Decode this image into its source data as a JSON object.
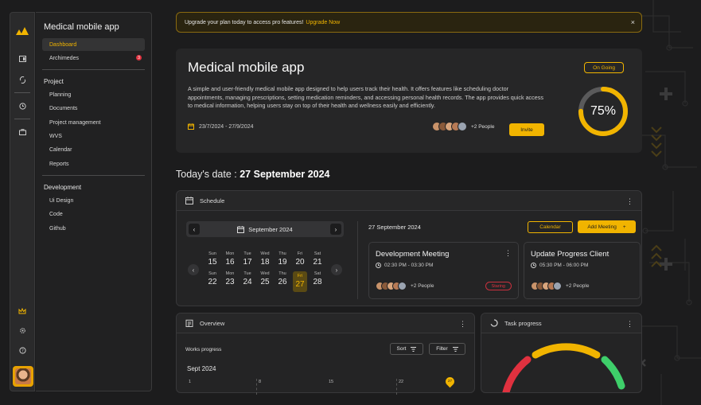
{
  "colors": {
    "accent": "#f1b400",
    "danger": "#e0313f",
    "success": "#3ecf6a"
  },
  "rail": {
    "icons": [
      "logo-icon",
      "window-icon",
      "link-icon",
      "history-icon",
      "briefcase-icon",
      "crown-icon",
      "settings-icon",
      "help-icon"
    ]
  },
  "sidebar": {
    "title": "Medical mobile app",
    "top_items": [
      {
        "label": "Dashboard",
        "active": true
      },
      {
        "label": "Archimedes",
        "badge": "3"
      }
    ],
    "groups": [
      {
        "title": "Project",
        "items": [
          "Planning",
          "Documents",
          "Project management",
          "WVS",
          "Calendar",
          "Reports"
        ]
      },
      {
        "title": "Development",
        "items": [
          "Ui Design",
          "Code",
          "Github"
        ]
      }
    ]
  },
  "banner": {
    "text": "Upgrade your plan today to access pro features!",
    "link": "Upgrade Now",
    "close": "×"
  },
  "hero": {
    "title": "Medical mobile app",
    "description": "A simple and user-friendly medical mobile app designed to help users track their health. It offers features like scheduling doctor appointments, managing prescriptions, setting medication reminders, and accessing personal health records. The app provides quick access to medical information, helping users stay on top of their health and wellness easily and efficiently.",
    "dates": "23/7/2024 - 27/9/2024",
    "status": "On Going",
    "people_count": "+2 People",
    "invite": "Invite",
    "progress_label": "75%",
    "progress": 0.75
  },
  "today": {
    "prefix": "Today's date :",
    "date": "27 September 2024"
  },
  "schedule": {
    "title": "Schedule",
    "month": "September 2024",
    "selected_date": "27 September 2024",
    "calendar_btn": "Calendar",
    "add_btn": "Add Meeting",
    "add_icon": "+",
    "week1": [
      {
        "dn": "Sun",
        "dd": "15"
      },
      {
        "dn": "Mon",
        "dd": "16"
      },
      {
        "dn": "Tue",
        "dd": "17"
      },
      {
        "dn": "Wed",
        "dd": "18"
      },
      {
        "dn": "Thu",
        "dd": "19"
      },
      {
        "dn": "Fri",
        "dd": "20"
      },
      {
        "dn": "Sat",
        "dd": "21"
      }
    ],
    "week2": [
      {
        "dn": "Sun",
        "dd": "22"
      },
      {
        "dn": "Mon",
        "dd": "23"
      },
      {
        "dn": "Tue",
        "dd": "24"
      },
      {
        "dn": "Wed",
        "dd": "25"
      },
      {
        "dn": "Thu",
        "dd": "26"
      },
      {
        "dn": "Fri",
        "dd": "27",
        "selected": true
      },
      {
        "dn": "Sat",
        "dd": "28"
      }
    ],
    "meetings": [
      {
        "title": "Development Meeting",
        "time": "02:30 PM - 03:30 PM",
        "people": "+2 People",
        "status": "Staring"
      },
      {
        "title": "Update Progress Client",
        "time": "05:30 PM - 06:00 PM",
        "people": "+2 People"
      }
    ]
  },
  "overview": {
    "title": "Overview",
    "label": "Works progress",
    "sort": "Sort",
    "filter": "Filter",
    "month": "Sept 2024",
    "ticks": [
      "1",
      "8",
      "15",
      "22"
    ],
    "marker": "27"
  },
  "task": {
    "title": "Task progress"
  }
}
